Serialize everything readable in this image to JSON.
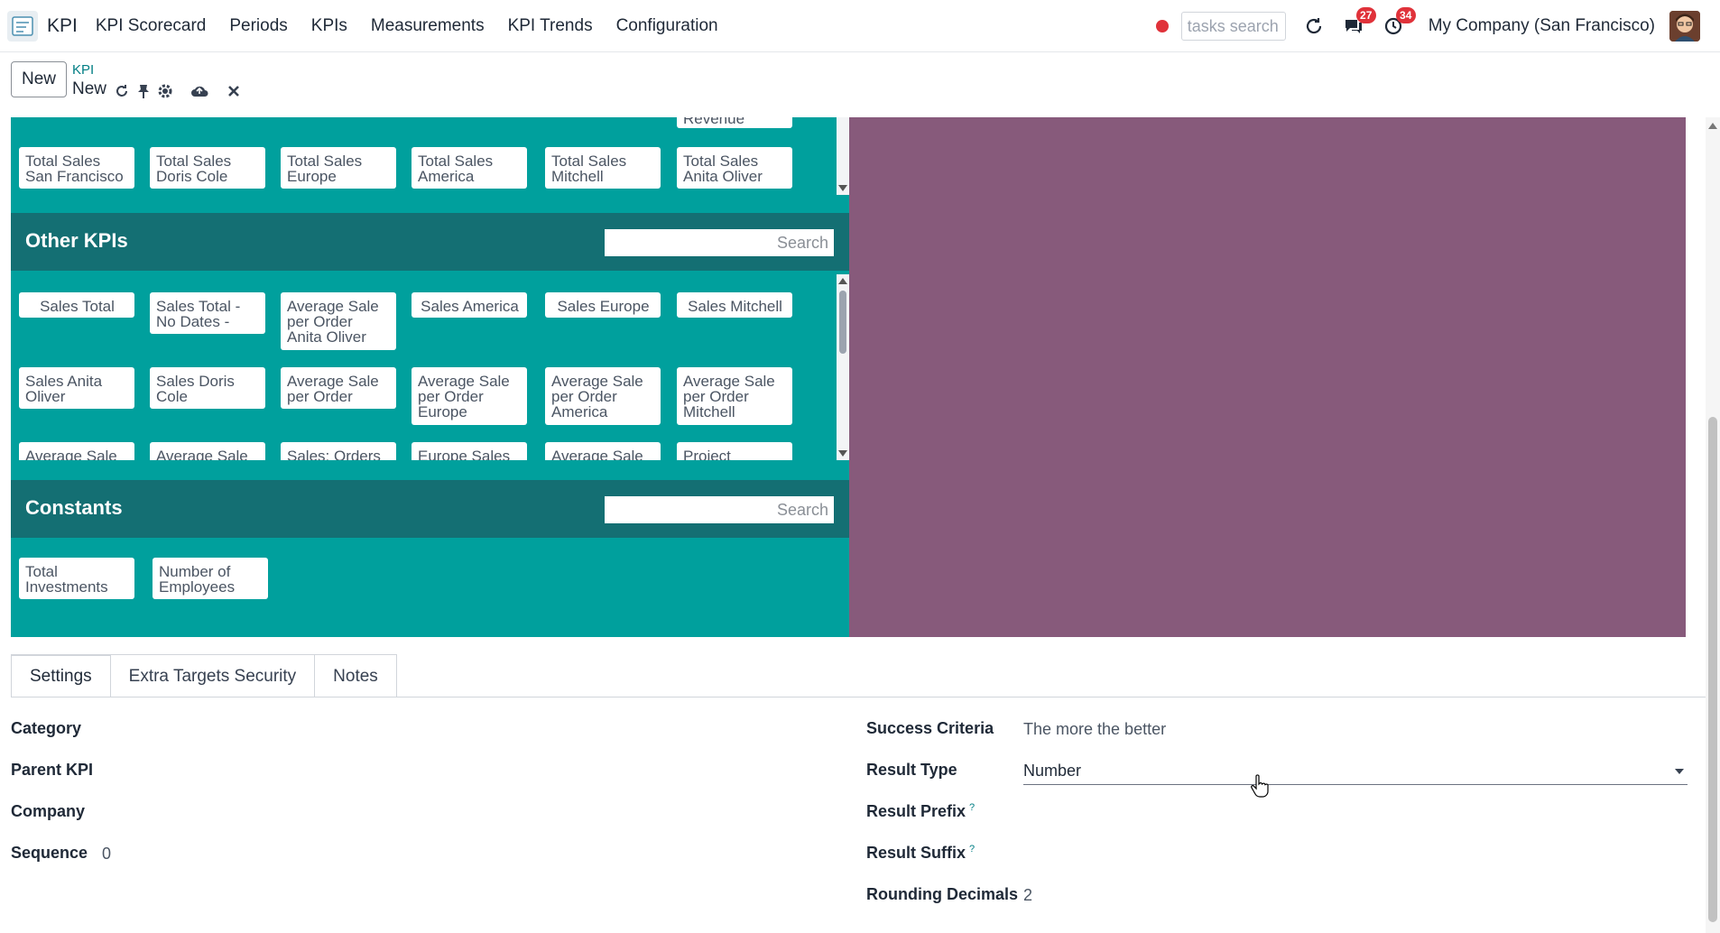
{
  "navbar": {
    "app_name": "KPI",
    "menu": [
      "KPI Scorecard",
      "Periods",
      "KPIs",
      "Measurements",
      "KPI Trends",
      "Configuration"
    ],
    "search_placeholder": "tasks search",
    "messages_count": "27",
    "activities_count": "34",
    "company": "My Company (San Francisco)"
  },
  "control_panel": {
    "new_label": "New",
    "breadcrumb_parent": "KPI",
    "breadcrumb_current": "New"
  },
  "formula_builder": {
    "top_row_partial": "Revenue",
    "top_chips": [
      "Total Sales San Francisco",
      "Total Sales Doris Cole",
      "Total Sales Europe",
      "Total Sales America",
      "Total Sales Mitchell",
      "Total Sales Anita Oliver"
    ],
    "other_kpis": {
      "title": "Other KPIs",
      "search_placeholder": "Search",
      "row1": [
        "Sales Total",
        "Sales Total - No Dates -",
        "Average Sale per Order Anita Oliver",
        "Sales America",
        "Sales Europe",
        "Sales Mitchell"
      ],
      "row2": [
        "Sales Anita Oliver",
        "Sales Doris Cole",
        "Average Sale per Order",
        "Average Sale per Order Europe",
        "Average Sale per Order America",
        "Average Sale per Order Mitchell"
      ],
      "row3": [
        "Average Sale",
        "Average Sale",
        "Sales: Orders",
        "Europe Sales",
        "Average Sale",
        "Project"
      ]
    },
    "constants": {
      "title": "Constants",
      "search_placeholder": "Search",
      "items": [
        "Total Investments",
        "Number of Employees"
      ]
    },
    "colors": {
      "kpi_panel": "#00a09d",
      "header": "#146f73",
      "formula_panel": "#875a7b"
    }
  },
  "tabs": [
    "Settings",
    "Extra Targets Security",
    "Notes"
  ],
  "form": {
    "category_label": "Category",
    "parent_kpi_label": "Parent KPI",
    "company_label": "Company",
    "sequence_label": "Sequence",
    "sequence_value": "0",
    "success_criteria_label": "Success Criteria",
    "success_criteria_value": "The more the better",
    "result_type_label": "Result Type",
    "result_type_value": "Number",
    "result_prefix_label": "Result Prefix",
    "result_suffix_label": "Result Suffix",
    "help_mark": "?",
    "rounding_label": "Rounding Decimals",
    "rounding_value": "2"
  }
}
